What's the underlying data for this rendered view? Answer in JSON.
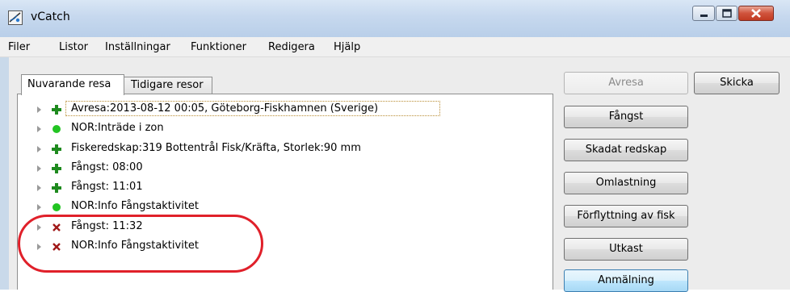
{
  "window": {
    "title": "vCatch",
    "icon": "fish-app-icon"
  },
  "menu": [
    "Filer",
    "Listor",
    "Inställningar",
    "Funktioner",
    "Redigera",
    "Hjälp"
  ],
  "tabs": {
    "active": "Nuvarande resa",
    "inactive": "Tidigare resor"
  },
  "tree": [
    {
      "status": "plus",
      "text": "Avresa:2013-08-12 00:05,  Göteborg-Fiskhamnen (Sverige)"
    },
    {
      "status": "ok",
      "text": "NOR:Inträde i zon"
    },
    {
      "status": "plus",
      "text": "Fiskeredskap:319 Bottentrål Fisk/Kräfta, Storlek:90 mm"
    },
    {
      "status": "plus",
      "text": "Fångst: 08:00"
    },
    {
      "status": "plus",
      "text": "Fångst: 11:01"
    },
    {
      "status": "ok",
      "text": "NOR:Info Fångstaktivitet"
    },
    {
      "status": "error",
      "text": "Fångst: 11:32"
    },
    {
      "status": "error",
      "text": "NOR:Info Fångstaktivitet"
    }
  ],
  "buttons": {
    "avresa": "Avresa",
    "skicka": "Skicka",
    "fangst": "Fångst",
    "skadat": "Skadat redskap",
    "omlastning": "Omlastning",
    "forflyttning": "Förflyttning av fisk",
    "utkast": "Utkast",
    "anmalning": "Anmälning"
  },
  "colors": {
    "plus": "#1e8a1e",
    "ok": "#22c422",
    "error": "#a01818",
    "annotation_ring": "#e0202a"
  }
}
